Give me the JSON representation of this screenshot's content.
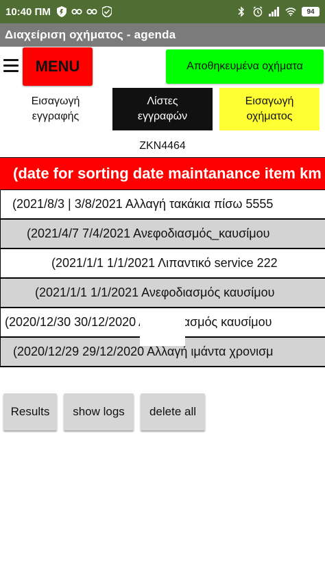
{
  "statusbar": {
    "time": "10:40 ΠΜ",
    "battery": "94"
  },
  "app": {
    "title": "Διαχείριση οχήματος - agenda"
  },
  "toolbar": {
    "menu_label": "MENU",
    "saved_vehicles_label": "Αποθηκευμένα οχήματα"
  },
  "tabs": {
    "entry_line1": "Εισαγωγή",
    "entry_line2": "εγγραφής",
    "lists_line1": "Λίστες",
    "lists_line2": "εγγραφών",
    "vehicle_line1": "Εισαγωγή",
    "vehicle_line2": "οχήματος"
  },
  "plate": "ZKN4464",
  "list": {
    "header": "(date for sorting date maintanance item km",
    "rows": [
      {
        "text": "(2021/8/3 | 3/8/2021 Αλλαγή τακάκια πίσω 5555"
      },
      {
        "text": "(2021/4/7 7/4/2021 Ανεφοδιασμός_καυσίμου"
      },
      {
        "text": "(2021/1/1 1/1/2021 Λιπαντικό service 222"
      },
      {
        "text": "(2021/1/1 1/1/2021 Ανεφοδιασμός καυσίμου"
      },
      {
        "text": "(2020/12/30 30/12/2020 Ανεφοδιασμός καυσίμου"
      },
      {
        "text": "(2020/12/29 29/12/2020 Αλλαγή ιμάντα χρονισμ"
      }
    ]
  },
  "buttons": {
    "results": "Results",
    "show_logs": "show logs",
    "delete_all": "delete all"
  },
  "colors": {
    "statusbar": "#506e33",
    "titlebar": "#7b7b7b",
    "menu": "#ff0000",
    "saved": "#00ff00",
    "vehicle_tab": "#ffff33",
    "header": "#ff0000",
    "row_alt": "#d3d3d3"
  }
}
